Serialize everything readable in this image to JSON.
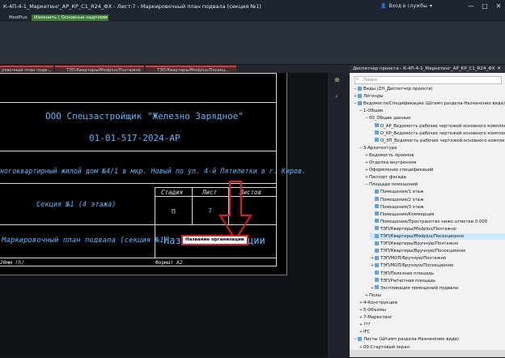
{
  "window": {
    "title": "К-4П-4-1_Маркетинг_АР_КР_С1_R24_ФХ - Лист:7 - Маркировочный план подвала (секция №1)",
    "signin_label": "Вход в службы",
    "controls": [
      "—",
      "□",
      "✕"
    ]
  },
  "ribbon": {
    "tabs": [
      "ModPlus",
      "Изменить | Основные надписи"
    ],
    "active_tab": 1
  },
  "file_tabs": [
    "ровочный план подв...",
    "ТЭП/Квартиры/Modplus/Поэтажно",
    "ТЭП/Квартиры/Modplus/Посекц..."
  ],
  "titleblock": {
    "company": "ООО Спецзастройщик \"Железно Зарядное\"",
    "code": "01-01-517-2024-АР",
    "project": "ногоквартирный жилой дом №4/1 в мкр. Новый по ул. 4-й Пятилетки в г. Киров.",
    "section": "Секция №1 (4 этажа)",
    "stage_header": "Стадия",
    "sheet_header": "Лист",
    "sheets_header": "Листов",
    "stage_value": "П",
    "sheet_value": "7",
    "drawing_title": "Маркировочный план подвала (секция №1)",
    "org_name_partial_left": "Наз",
    "org_name_partial_right": "ции",
    "org_label": "Название организации",
    "scale_fragment": "20мм (h)",
    "format": "Формат А2"
  },
  "panel": {
    "title": "Диспетчер проекта - К-4П-4-1_Маркетинг_АР_КР_С1_R24_ФХ",
    "search_placeholder": "Поиск",
    "tree": [
      {
        "label": "Виды (ZH_Диспетчер проекта)",
        "toggle": "−",
        "level": 0,
        "icon": true
      },
      {
        "label": "Легенды",
        "toggle": "+",
        "level": 0,
        "icon": true
      },
      {
        "label": "Ведомости/Спецификации (Штамп раздела-Назначение вида)",
        "toggle": "−",
        "level": 0,
        "icon": true
      },
      {
        "label": "1-Общие",
        "toggle": "−",
        "level": 1,
        "icon": false
      },
      {
        "label": "00_Общие данные",
        "toggle": "−",
        "level": 2,
        "icon": false
      },
      {
        "label": "О_АР_Ведомость рабочих чертежей основного комплек",
        "toggle": "",
        "level": 3,
        "icon": true
      },
      {
        "label": "О_КР_Ведомость рабочих чертежей основного комплек",
        "toggle": "",
        "level": 3,
        "icon": true
      },
      {
        "label": "О_ЭП_Ведомость рабочих чертежей основного комплек",
        "toggle": "",
        "level": 3,
        "icon": true
      },
      {
        "label": "3-Архитектура",
        "toggle": "−",
        "level": 1,
        "icon": false
      },
      {
        "label": "Ведомость проемов",
        "toggle": "+",
        "level": 2,
        "icon": false
      },
      {
        "label": "Отделка внутренняя",
        "toggle": "+",
        "level": 2,
        "icon": false
      },
      {
        "label": "Оформление спецификаций",
        "toggle": "+",
        "level": 2,
        "icon": false
      },
      {
        "label": "Паспорт фасада",
        "toggle": "+",
        "level": 2,
        "icon": false
      },
      {
        "label": "Площади помещений",
        "toggle": "−",
        "level": 2,
        "icon": false
      },
      {
        "label": "Помещения/1 этаж",
        "toggle": "",
        "level": 3,
        "icon": true
      },
      {
        "label": "Помещения/2 этаж",
        "toggle": "",
        "level": 3,
        "icon": true
      },
      {
        "label": "Помещения/3 этаж",
        "toggle": "",
        "level": 3,
        "icon": true
      },
      {
        "label": "Помещения/Коммерция",
        "toggle": "",
        "level": 3,
        "icon": true
      },
      {
        "label": "Помещения/Пространство ниже отметки 0.000",
        "toggle": "",
        "level": 3,
        "icon": true
      },
      {
        "label": "ТЭП/Квартиры/Modplus/Поэтажно",
        "toggle": "",
        "level": 3,
        "icon": true
      },
      {
        "label": "ТЭП/Квартиры/Modplus/Посекционно",
        "toggle": "",
        "level": 3,
        "icon": true,
        "selected": true
      },
      {
        "label": "ТЭП/Квартиры/Вручную/Поэтажно",
        "toggle": "",
        "level": 3,
        "icon": true
      },
      {
        "label": "ТЭП/Квартиры/Вручную/Посекционно",
        "toggle": "",
        "level": 3,
        "icon": true
      },
      {
        "label": "ТЭП/МОП/Вручную/Поэтажно",
        "toggle": "+",
        "level": 3,
        "icon": true
      },
      {
        "label": "ТЭП/МОП/Вручную/Посекционно",
        "toggle": "+",
        "level": 3,
        "icon": true
      },
      {
        "label": "ТЭП/Полезная площадь",
        "toggle": "",
        "level": 3,
        "icon": true
      },
      {
        "label": "ТЭП/Расчетная площадь",
        "toggle": "",
        "level": 3,
        "icon": true
      },
      {
        "label": "Экспликация помещений подвала",
        "toggle": "+",
        "level": 3,
        "icon": true
      },
      {
        "label": "Полы",
        "toggle": "+",
        "level": 2,
        "icon": false
      },
      {
        "label": "4-Конструкции",
        "toggle": "+",
        "level": 1,
        "icon": false
      },
      {
        "label": "5-Объемы",
        "toggle": "+",
        "level": 1,
        "icon": false
      },
      {
        "label": "7-Маркетинг",
        "toggle": "+",
        "level": 1,
        "icon": false
      },
      {
        "label": "???",
        "toggle": "+",
        "level": 1,
        "icon": false
      },
      {
        "label": "IFC",
        "toggle": "+",
        "level": 1,
        "icon": false
      },
      {
        "label": "Листы (Штамп раздела-Назначение вида)",
        "toggle": "−",
        "level": 0,
        "icon": true
      },
      {
        "label": "00-Стартовый экран",
        "toggle": "+",
        "level": 1,
        "icon": false
      },
      {
        "label": "???",
        "toggle": "+",
        "level": 1,
        "icon": false
      }
    ]
  },
  "colors": {
    "annotation_red": "#e21c1c",
    "cad_blue": "#5ab7ff",
    "active_tab_green": "#3e7a36"
  }
}
